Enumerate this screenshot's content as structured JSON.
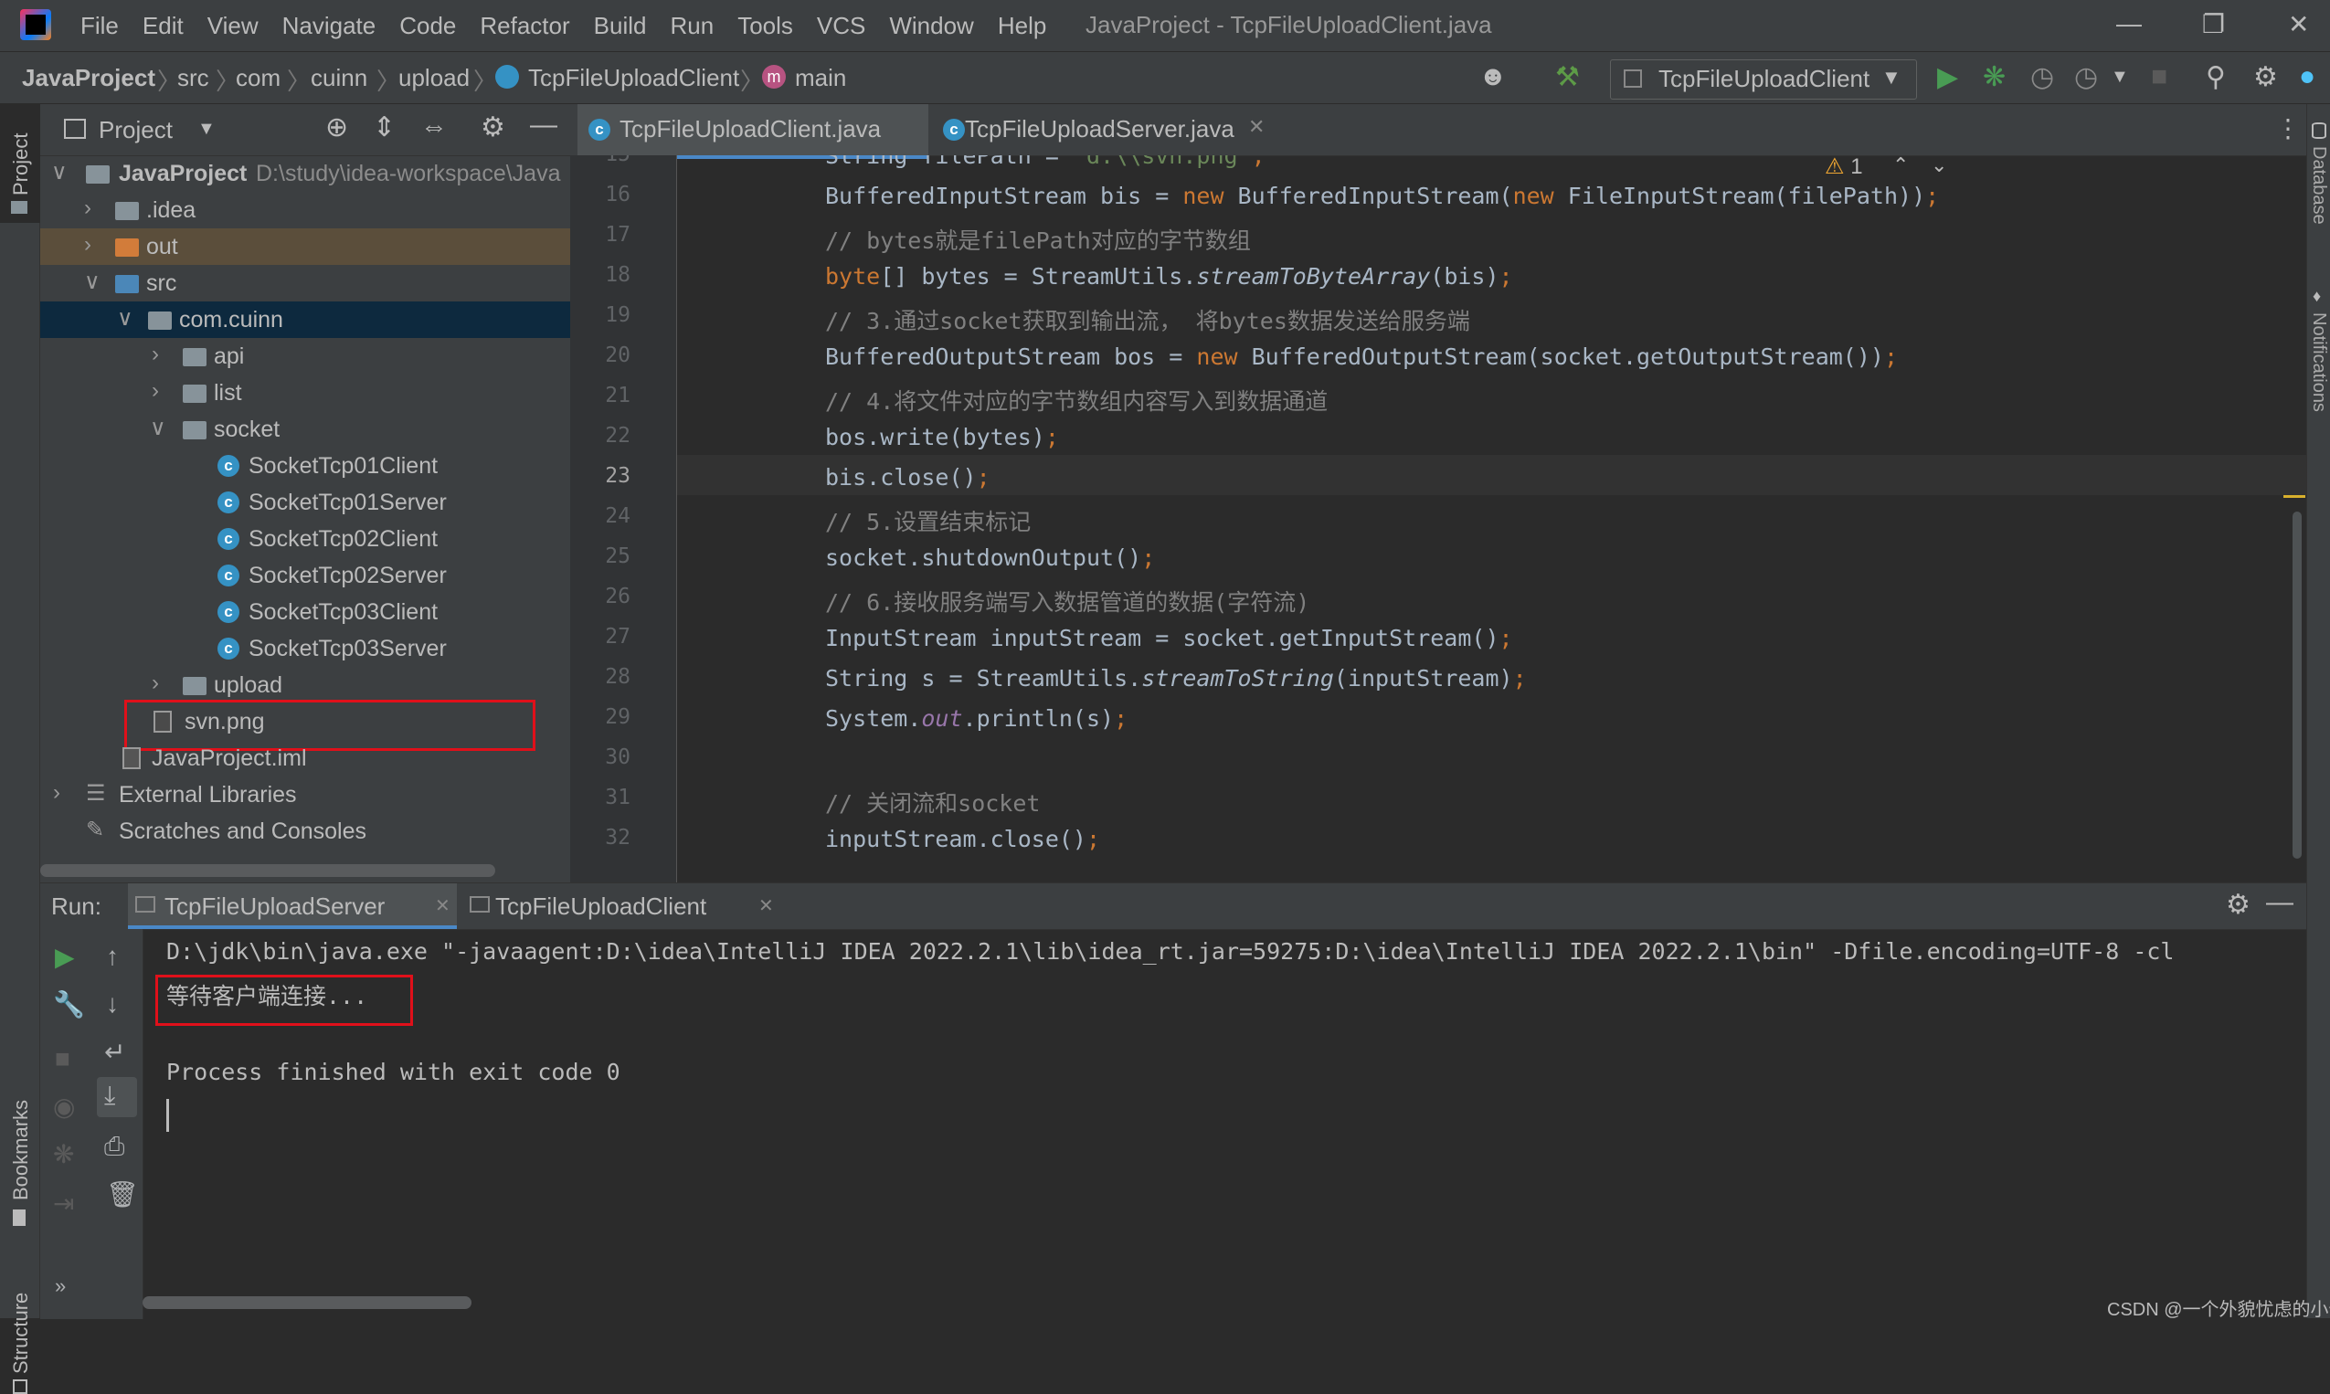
{
  "menu": [
    "File",
    "Edit",
    "View",
    "Navigate",
    "Code",
    "Refactor",
    "Build",
    "Run",
    "Tools",
    "VCS",
    "Window",
    "Help"
  ],
  "window_title": "JavaProject - TcpFileUploadClient.java",
  "breadcrumbs": [
    "JavaProject",
    "src",
    "com",
    "cuinn",
    "upload",
    "TcpFileUploadClient",
    "main"
  ],
  "run_config": "TcpFileUploadClient",
  "left_strip": {
    "project": "Project",
    "bookmarks": "Bookmarks",
    "structure": "Structure"
  },
  "right_strip": {
    "database": "Database",
    "notifications": "Notifications"
  },
  "project_panel": {
    "title": "Project",
    "tree": [
      {
        "label": "JavaProject",
        "extra": "D:\\study\\idea-workspace\\Java",
        "type": "module",
        "depth": 0,
        "expanded": true
      },
      {
        "label": ".idea",
        "type": "folder",
        "depth": 1,
        "expanded": false
      },
      {
        "label": "out",
        "type": "folder-orange",
        "depth": 1,
        "expanded": false
      },
      {
        "label": "src",
        "type": "folder-blue",
        "depth": 1,
        "expanded": true
      },
      {
        "label": "com.cuinn",
        "type": "package",
        "depth": 2,
        "expanded": true
      },
      {
        "label": "api",
        "type": "package",
        "depth": 3,
        "expanded": false
      },
      {
        "label": "list",
        "type": "package",
        "depth": 3,
        "expanded": false
      },
      {
        "label": "socket",
        "type": "package",
        "depth": 3,
        "expanded": true
      },
      {
        "label": "SocketTcp01Client",
        "type": "class",
        "depth": 4
      },
      {
        "label": "SocketTcp01Server",
        "type": "class",
        "depth": 4
      },
      {
        "label": "SocketTcp02Client",
        "type": "class",
        "depth": 4
      },
      {
        "label": "SocketTcp02Server",
        "type": "class",
        "depth": 4
      },
      {
        "label": "SocketTcp03Client",
        "type": "class",
        "depth": 4
      },
      {
        "label": "SocketTcp03Server",
        "type": "class",
        "depth": 4
      },
      {
        "label": "upload",
        "type": "package",
        "depth": 3,
        "expanded": false
      },
      {
        "label": "svn.png",
        "type": "file",
        "depth": 2
      },
      {
        "label": "JavaProject.iml",
        "type": "iml",
        "depth": 1
      },
      {
        "label": "External Libraries",
        "type": "lib",
        "depth": 0,
        "expanded": false
      },
      {
        "label": "Scratches and Consoles",
        "type": "scratch",
        "depth": 0
      }
    ]
  },
  "editor": {
    "tabs": [
      {
        "label": "TcpFileUploadClient.java",
        "active": true
      },
      {
        "label": "TcpFileUploadServer.java",
        "active": false
      }
    ],
    "warnings": "1",
    "line_numbers": [
      "15",
      "16",
      "17",
      "18",
      "19",
      "20",
      "21",
      "22",
      "23",
      "24",
      "25",
      "26",
      "27",
      "28",
      "29",
      "30",
      "31",
      "32"
    ],
    "lines": [
      "String filePath = \"d:\\\\svn.png\";",
      "BufferedInputStream bis = new BufferedInputStream(new FileInputStream(filePath));",
      "// bytes就是filePath对应的字节数组",
      "byte[] bytes = StreamUtils.streamToByteArray(bis);",
      "// 3.通过socket获取到输出流， 将bytes数据发送给服务端",
      "BufferedOutputStream bos = new BufferedOutputStream(socket.getOutputStream());",
      "// 4.将文件对应的字节数组内容写入到数据通道",
      "bos.write(bytes);",
      "bis.close();",
      "// 5.设置结束标记",
      "socket.shutdownOutput();",
      "// 6.接收服务端写入数据管道的数据(字符流)",
      "InputStream inputStream = socket.getInputStream();",
      "String s = StreamUtils.streamToString(inputStream);",
      "System.out.println(s);",
      "",
      "// 关闭流和socket",
      "inputStream.close();"
    ]
  },
  "run_panel": {
    "label": "Run:",
    "tabs": [
      {
        "label": "TcpFileUploadServer",
        "active": true
      },
      {
        "label": "TcpFileUploadClient",
        "active": false
      }
    ],
    "console": [
      "D:\\jdk\\bin\\java.exe \"-javaagent:D:\\idea\\IntelliJ IDEA 2022.2.1\\lib\\idea_rt.jar=59275:D:\\idea\\IntelliJ IDEA 2022.2.1\\bin\" -Dfile.encoding=UTF-8 -cl",
      "等待客户端连接...",
      "",
      "Process finished with exit code 0"
    ]
  },
  "watermark": "CSDN @一个外貌忧虑的小伙儿"
}
